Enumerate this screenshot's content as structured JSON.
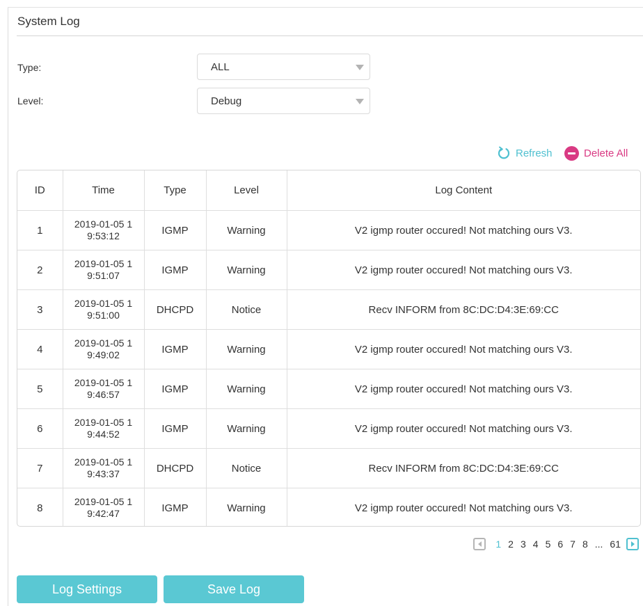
{
  "panel": {
    "title": "System Log"
  },
  "filters": {
    "type": {
      "label": "Type:",
      "value": "ALL"
    },
    "level": {
      "label": "Level:",
      "value": "Debug"
    }
  },
  "actions": {
    "refresh": "Refresh",
    "delete_all": "Delete All"
  },
  "table": {
    "headers": {
      "id": "ID",
      "time": "Time",
      "type": "Type",
      "level": "Level",
      "content": "Log Content"
    },
    "rows": [
      {
        "id": "1",
        "time1": "2019-01-05 1",
        "time2": "9:53:12",
        "type": "IGMP",
        "level": "Warning",
        "content": "V2 igmp router occured! Not matching ours V3."
      },
      {
        "id": "2",
        "time1": "2019-01-05 1",
        "time2": "9:51:07",
        "type": "IGMP",
        "level": "Warning",
        "content": "V2 igmp router occured! Not matching ours V3."
      },
      {
        "id": "3",
        "time1": "2019-01-05 1",
        "time2": "9:51:00",
        "type": "DHCPD",
        "level": "Notice",
        "content": "Recv INFORM from 8C:DC:D4:3E:69:CC"
      },
      {
        "id": "4",
        "time1": "2019-01-05 1",
        "time2": "9:49:02",
        "type": "IGMP",
        "level": "Warning",
        "content": "V2 igmp router occured! Not matching ours V3."
      },
      {
        "id": "5",
        "time1": "2019-01-05 1",
        "time2": "9:46:57",
        "type": "IGMP",
        "level": "Warning",
        "content": "V2 igmp router occured! Not matching ours V3."
      },
      {
        "id": "6",
        "time1": "2019-01-05 1",
        "time2": "9:44:52",
        "type": "IGMP",
        "level": "Warning",
        "content": "V2 igmp router occured! Not matching ours V3."
      },
      {
        "id": "7",
        "time1": "2019-01-05 1",
        "time2": "9:43:37",
        "type": "DHCPD",
        "level": "Notice",
        "content": "Recv INFORM from 8C:DC:D4:3E:69:CC"
      },
      {
        "id": "8",
        "time1": "2019-01-05 1",
        "time2": "9:42:47",
        "type": "IGMP",
        "level": "Warning",
        "content": "V2 igmp router occured! Not matching ours V3."
      }
    ]
  },
  "pagination": {
    "pages": [
      "1",
      "2",
      "3",
      "4",
      "5",
      "6",
      "7",
      "8"
    ],
    "ellipsis": "...",
    "last": "61",
    "current": "1"
  },
  "buttons": {
    "log_settings": "Log Settings",
    "save_log": "Save Log"
  },
  "colors": {
    "accent": "#4fc0d0",
    "danger": "#d93a83",
    "button": "#5ac8d3"
  },
  "icons": {
    "refresh": "refresh-icon",
    "delete": "delete-icon",
    "dropdown": "chevron-down-icon",
    "prev": "prev-page-icon",
    "next": "next-page-icon"
  }
}
